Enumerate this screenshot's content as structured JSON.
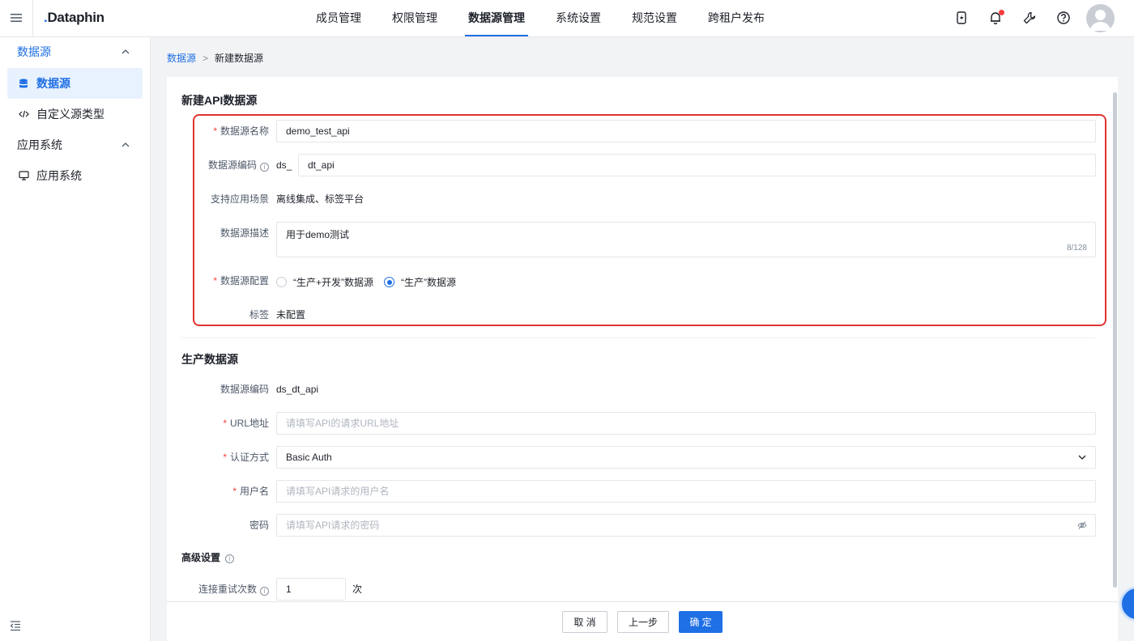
{
  "app": {
    "logo_text": "ataphin",
    "logo_prefix": "D"
  },
  "topnav": [
    {
      "label": "成员管理",
      "active": false
    },
    {
      "label": "权限管理",
      "active": false
    },
    {
      "label": "数据源管理",
      "active": true
    },
    {
      "label": "系统设置",
      "active": false
    },
    {
      "label": "规范设置",
      "active": false
    },
    {
      "label": "跨租户发布",
      "active": false
    }
  ],
  "top_icons": [
    "lightning-icon",
    "bell-icon",
    "wrench-icon",
    "help-icon"
  ],
  "sidebar": {
    "groups": [
      {
        "label": "数据源",
        "items": [
          {
            "label": "数据源",
            "icon": "database-icon",
            "active": true
          },
          {
            "label": "自定义源类型",
            "icon": "code-icon",
            "active": false
          }
        ]
      },
      {
        "label": "应用系统",
        "items": [
          {
            "label": "应用系统",
            "icon": "monitor-icon",
            "active": false
          }
        ]
      }
    ]
  },
  "breadcrumb": {
    "parent": "数据源",
    "separator": ">",
    "current": "新建数据源"
  },
  "form": {
    "title": "新建API数据源",
    "name_label": "数据源名称",
    "name_value": "demo_test_api",
    "code_label": "数据源编码",
    "code_prefix": "ds_",
    "code_value": "dt_api",
    "scene_label": "支持应用场景",
    "scene_value": "离线集成、标签平台",
    "desc_label": "数据源描述",
    "desc_value": "用于demo测试",
    "desc_count": "8/128",
    "config_label": "数据源配置",
    "config_options": [
      "“生产+开发”数据源",
      "“生产”数据源"
    ],
    "config_selected": 1,
    "tag_label": "标签",
    "tag_value": "未配置"
  },
  "production": {
    "title": "生产数据源",
    "code_label": "数据源编码",
    "code_value": "ds_dt_api",
    "url_label": "URL地址",
    "url_placeholder": "请填写API的请求URL地址",
    "auth_label": "认证方式",
    "auth_value": "Basic Auth",
    "user_label": "用户名",
    "user_placeholder": "请填写API请求的用户名",
    "pwd_label": "密码",
    "pwd_placeholder": "请填写API请求的密码"
  },
  "advanced": {
    "title": "高级设置",
    "retry_label": "连接重试次数",
    "retry_value": "1",
    "retry_unit": "次"
  },
  "footer": {
    "cancel": "取 消",
    "prev": "上一步",
    "confirm": "确 定"
  },
  "colors": {
    "accent": "#1f6fe5",
    "highlight_box": "#e0332f",
    "required": "#f53f3f"
  }
}
